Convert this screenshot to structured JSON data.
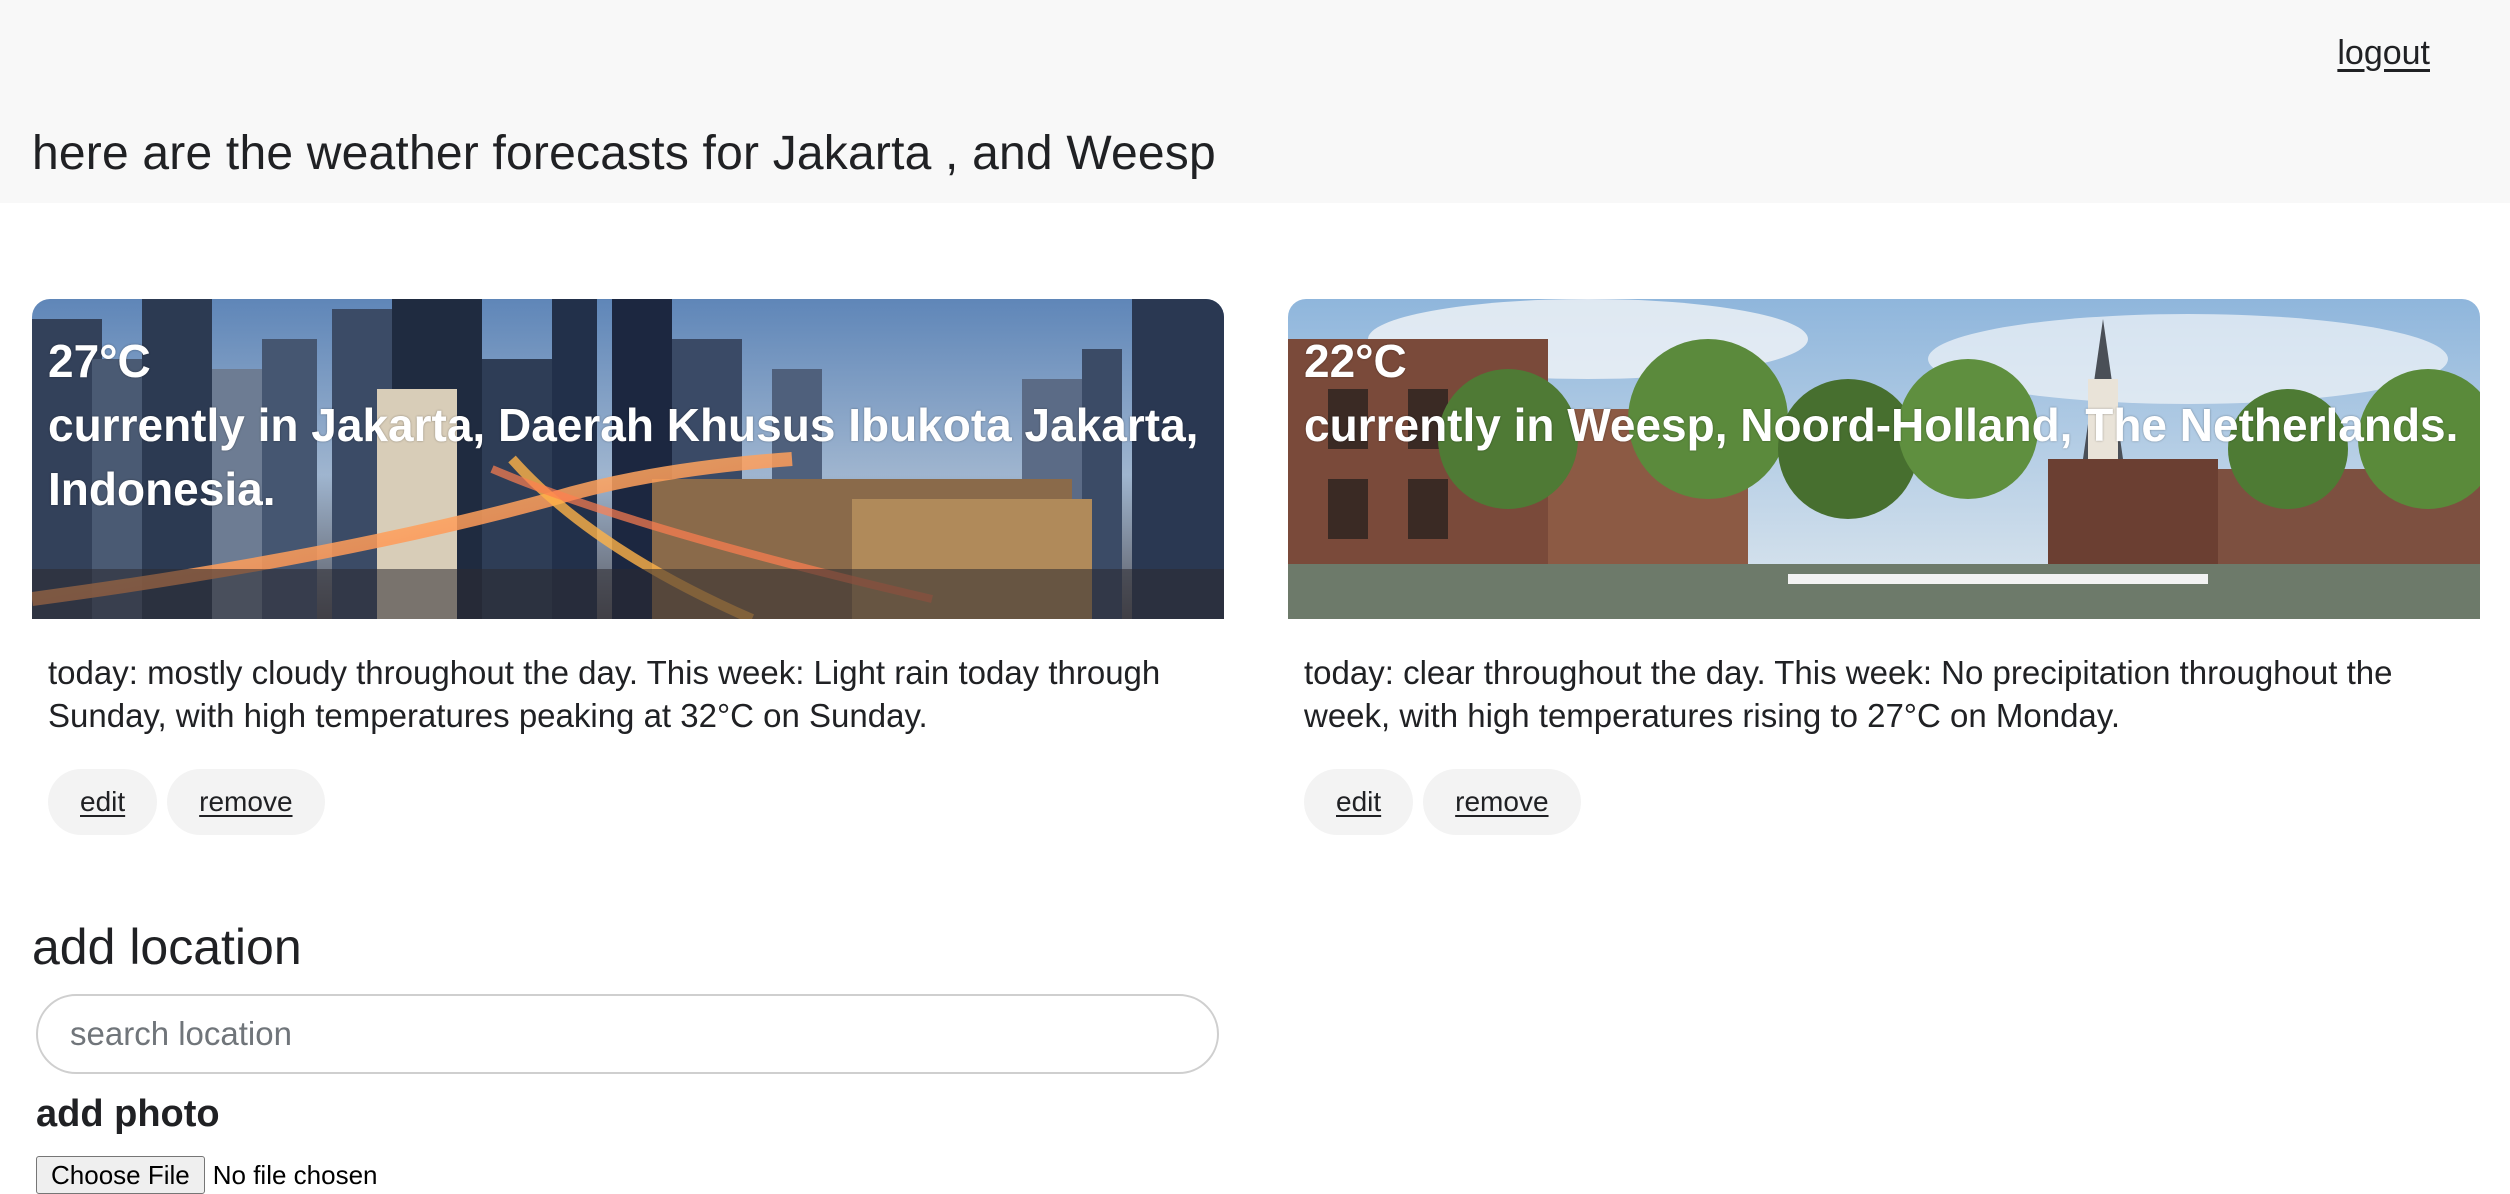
{
  "header": {
    "logout_label": "logout",
    "title": "here are the weather forecasts for Jakarta , and Weesp"
  },
  "cards": [
    {
      "temperature": "27°C",
      "location_line": "currently in Jakarta, Daerah Khusus Ibukota Jakarta, Indonesia.",
      "description": "today: mostly cloudy throughout the day. This week: Light rain today through Sunday, with high temperatures peaking at 32°C on Sunday.",
      "edit_label": "edit",
      "remove_label": "remove"
    },
    {
      "temperature": "22°C",
      "location_line": "currently in Weesp, Noord-Holland, The Netherlands.",
      "description": "today: clear throughout the day. This week: No precipitation throughout the week, with high temperatures rising to 27°C on Monday.",
      "edit_label": "edit",
      "remove_label": "remove"
    }
  ],
  "add_location": {
    "title": "add location",
    "search_placeholder": "search location",
    "photo_label": "add photo",
    "file_button_label": "Choose File",
    "file_status": "No file chosen"
  }
}
